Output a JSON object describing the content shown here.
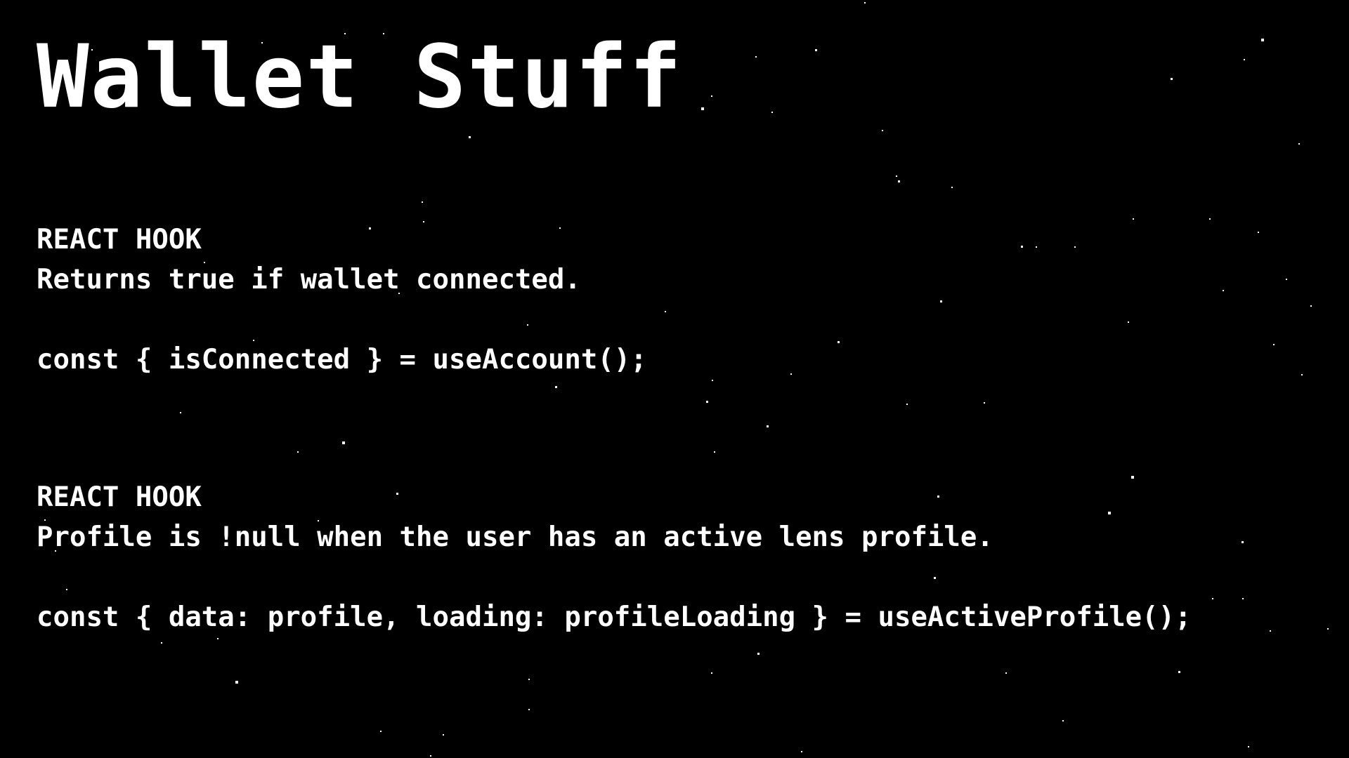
{
  "slide": {
    "title": "Wallet Stuff",
    "background_color": "#000000",
    "text_color": "#ffffff"
  },
  "sections": [
    {
      "label": "REACT HOOK",
      "description": "Returns true if wallet connected.",
      "code": "const { isConnected } = useAccount();"
    },
    {
      "label": "REACT HOOK",
      "description": "Profile is !null when the user has an active lens profile.",
      "code": "const { data: profile, loading: profileLoading } = useActiveProfile();"
    }
  ]
}
